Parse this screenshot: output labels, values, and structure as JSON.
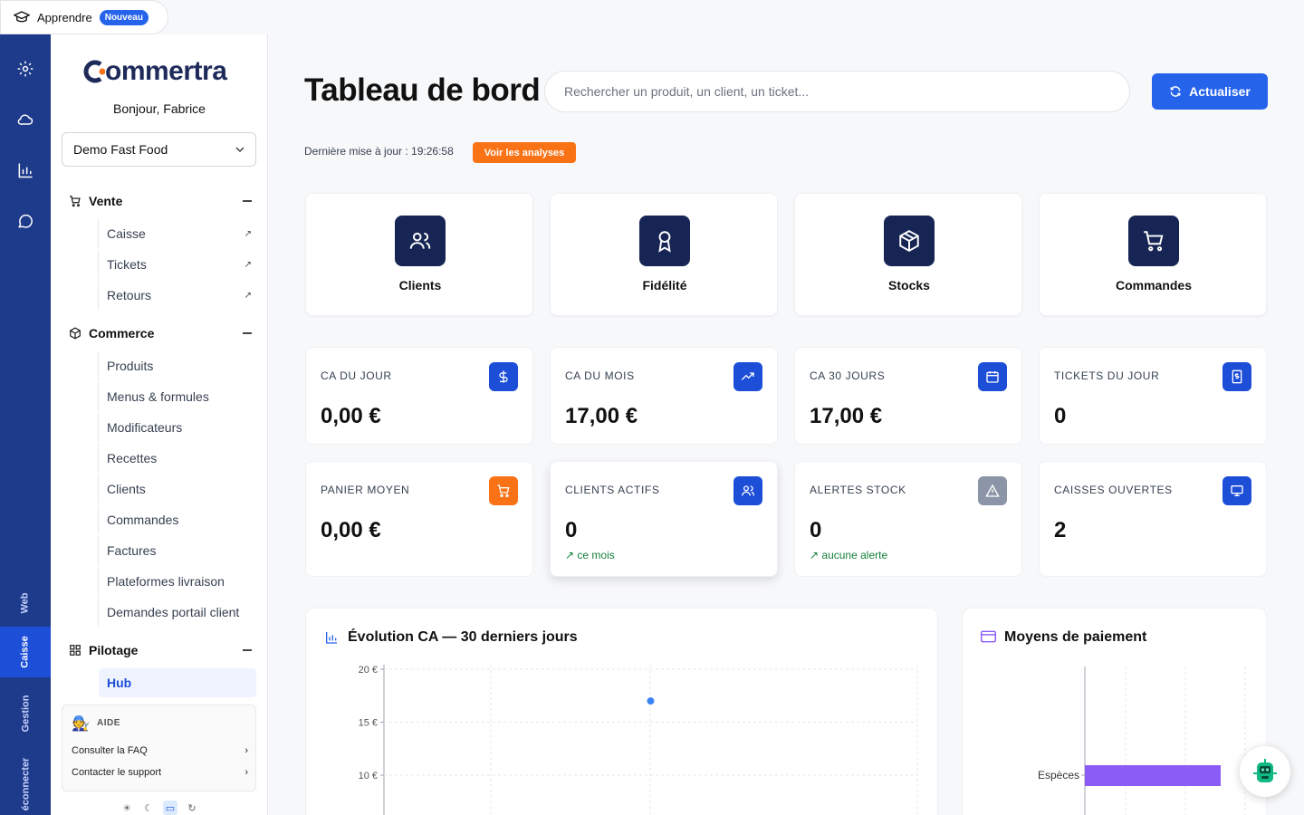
{
  "topbar": {
    "learn_label": "Apprendre",
    "learn_badge": "Nouveau"
  },
  "rail": {
    "icons": [
      "gear-icon",
      "cloud-icon",
      "chart-icon",
      "chat-icon"
    ],
    "tabs": [
      "Web",
      "Caisse",
      "Gestion",
      "éconnecter"
    ]
  },
  "sidebar": {
    "logo": "ommertra",
    "greeting": "Bonjour, Fabrice",
    "store": "Demo Fast Food",
    "sections": {
      "vente": {
        "label": "Vente",
        "items": [
          "Caisse",
          "Tickets",
          "Retours"
        ]
      },
      "commerce": {
        "label": "Commerce",
        "items": [
          "Produits",
          "Menus & formules",
          "Modificateurs",
          "Recettes",
          "Clients",
          "Commandes",
          "Factures",
          "Plateformes livraison",
          "Demandes portail client"
        ]
      },
      "pilotage": {
        "label": "Pilotage",
        "items": [
          "Hub"
        ]
      }
    },
    "help": {
      "title": "AIDE",
      "faq": "Consulter la FAQ",
      "support": "Contacter le support"
    }
  },
  "header": {
    "title": "Tableau de bord",
    "search_placeholder": "Rechercher un produit, un client, un ticket...",
    "refresh_label": "Actualiser",
    "updated": "Dernière mise à jour : 19:26:58",
    "analyses_label": "Voir les analyses"
  },
  "quick": [
    "Clients",
    "Fidélité",
    "Stocks",
    "Commandes"
  ],
  "stats": [
    {
      "label": "CA DU JOUR",
      "value": "0,00 €",
      "icon": "dollar-icon",
      "color": "#1d4ed8"
    },
    {
      "label": "CA DU MOIS",
      "value": "17,00 €",
      "icon": "trend-up-icon",
      "color": "#1d4ed8"
    },
    {
      "label": "CA 30 JOURS",
      "value": "17,00 €",
      "icon": "calendar-icon",
      "color": "#1d4ed8"
    },
    {
      "label": "TICKETS DU JOUR",
      "value": "0",
      "icon": "receipt-icon",
      "color": "#1d4ed8"
    },
    {
      "label": "PANIER MOYEN",
      "value": "0,00 €",
      "icon": "cart-icon",
      "color": "#f97316"
    },
    {
      "label": "CLIENTS ACTIFS",
      "value": "0",
      "icon": "users-icon",
      "color": "#1d4ed8",
      "sub": "ce mois"
    },
    {
      "label": "ALERTES STOCK",
      "value": "0",
      "icon": "warning-icon",
      "color": "#8b95a7",
      "sub": "aucune alerte"
    },
    {
      "label": "CAISSES OUVERTES",
      "value": "2",
      "icon": "monitor-icon",
      "color": "#1d4ed8"
    }
  ],
  "panels": {
    "revenue": {
      "title": "Évolution CA — 30 derniers jours"
    },
    "payments": {
      "title": "Moyens de paiement"
    }
  },
  "chart_data": [
    {
      "type": "scatter",
      "title": "Évolution CA — 30 derniers jours",
      "ylabel": "",
      "ylim": [
        0,
        20
      ],
      "yticks": [
        "20 €",
        "15 €",
        "10 €"
      ],
      "points": [
        {
          "x": 15,
          "y": 17
        }
      ]
    },
    {
      "type": "bar",
      "title": "Moyens de paiement",
      "categories": [
        "Espèces"
      ],
      "values": [
        17
      ],
      "color": "#8b5cf6"
    }
  ]
}
